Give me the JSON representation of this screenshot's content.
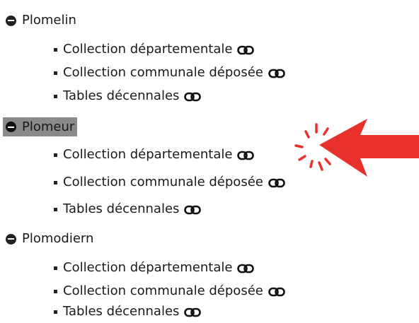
{
  "tree": [
    {
      "name": "Plomelin",
      "highlighted": false,
      "items": [
        {
          "label": "Collection départementale",
          "icon": "link-icon"
        },
        {
          "label": "Collection communale déposée",
          "icon": "link-icon"
        },
        {
          "label": "Tables décennales",
          "icon": "link-icon"
        }
      ]
    },
    {
      "name": "Plomeur",
      "highlighted": true,
      "items": [
        {
          "label": "Collection départementale",
          "icon": "link-icon"
        },
        {
          "label": "Collection communale déposée",
          "icon": "link-icon"
        },
        {
          "label": "Tables décennales",
          "icon": "link-icon"
        }
      ]
    },
    {
      "name": "Plomodiern",
      "highlighted": false,
      "items": [
        {
          "label": "Collection départementale",
          "icon": "link-icon"
        },
        {
          "label": "Collection communale déposée",
          "icon": "link-icon"
        },
        {
          "label": "Tables décennales",
          "icon": "link-icon"
        }
      ]
    }
  ],
  "annotation": {
    "arrow_color": "#e8312a",
    "click_burst_color": "#e8312a",
    "target": "link-icon"
  }
}
